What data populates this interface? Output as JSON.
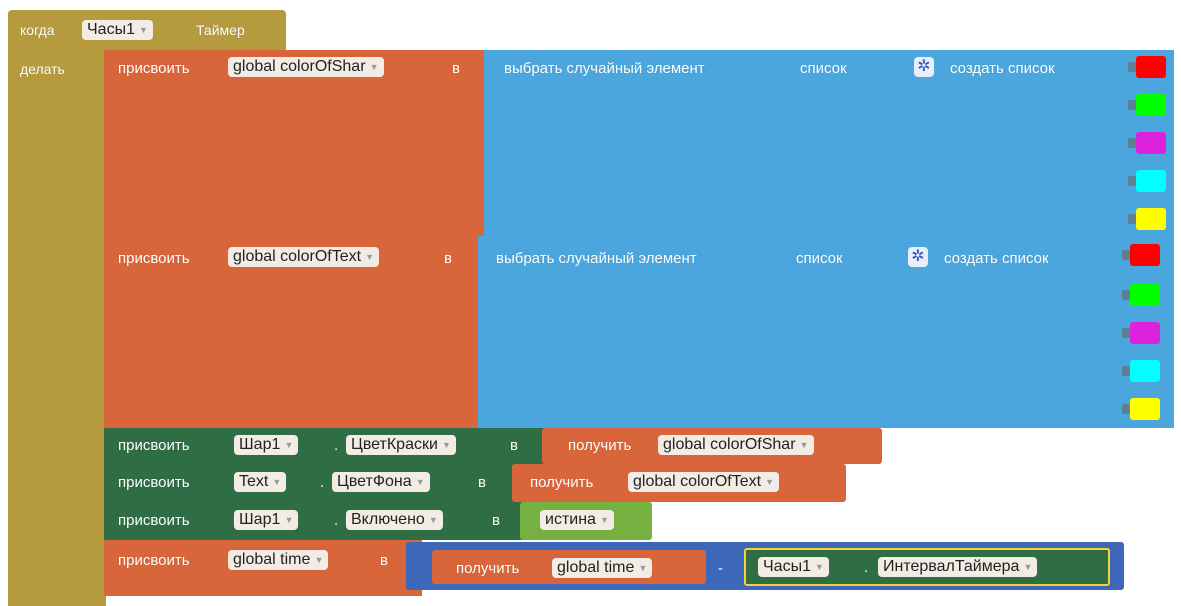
{
  "event": {
    "when": "когда",
    "component": "Часы1",
    "event_name": "Таймер",
    "do": "делать"
  },
  "kw": {
    "set": "присвоить",
    "to": "в",
    "pick_random": "выбрать случайный элемент",
    "list": "список",
    "make_list": "создать список",
    "get": "получить",
    "minus": "-"
  },
  "set1": {
    "var": "global colorOfShar"
  },
  "set2": {
    "var": "global colorOfText"
  },
  "set3": {
    "component": "Шар1",
    "property": "ЦветКраски",
    "get_var": "global colorOfShar"
  },
  "set4": {
    "component": "Text",
    "property": "ЦветФона",
    "get_var": "global colorOfText"
  },
  "set5": {
    "component": "Шар1",
    "property": "Включено",
    "value": "истина"
  },
  "set6": {
    "var": "global time",
    "get_var": "global time",
    "component": "Часы1",
    "property": "ИнтервалТаймера"
  },
  "colors": {
    "event_block": "#b59a3e",
    "variable_block": "#d9663a",
    "list_block": "#4aa6dc",
    "component_block": "#2f6e45",
    "logic_block": "#76b041",
    "math_block": "#3d67b8",
    "swatches": [
      "#ff0000",
      "#00ff00",
      "#dd22dd",
      "#00ffff",
      "#ffff00"
    ]
  }
}
